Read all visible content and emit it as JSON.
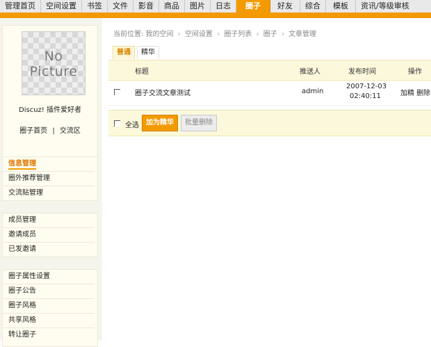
{
  "nav": {
    "tabs": [
      {
        "label": "管理首页"
      },
      {
        "label": "空间设置"
      },
      {
        "label": "书签"
      },
      {
        "label": "文件"
      },
      {
        "label": "影音"
      },
      {
        "label": "商品"
      },
      {
        "label": "图片"
      },
      {
        "label": "日志"
      },
      {
        "label": "圈子",
        "active": true
      },
      {
        "label": "好友"
      },
      {
        "label": "综合"
      },
      {
        "label": "模板"
      },
      {
        "label": "资讯/等级审核"
      }
    ],
    "accent": "#f29a00"
  },
  "sidebar": {
    "avatar_text": {
      "line1": "No",
      "line2": "Picture"
    },
    "profile_name": "Discuz! 插件爱好者",
    "profile_link1": "圈子首页",
    "profile_link_sep": "|",
    "profile_link2": "交流区",
    "group1": [
      "信息管理",
      "圈外推荐管理",
      "交流贴管理"
    ],
    "group2": [
      "成员管理",
      "邀请成员",
      "已发邀请"
    ],
    "group3": [
      "圈子属性设置",
      "圈子公告",
      "圈子风格",
      "共享风格",
      "转让圈子"
    ]
  },
  "main": {
    "breadcrumb": {
      "prefix": "当前位置: 我的空间",
      "items": [
        "空间设置",
        "圈子列表",
        "圈子",
        "文章管理"
      ],
      "sep": "›"
    },
    "subtabs": [
      "普通",
      "精华"
    ],
    "table": {
      "headers": {
        "title": "标题",
        "sender": "推送人",
        "time": "发布时间",
        "action": "操作"
      },
      "rows": [
        {
          "title": "圈子交流文章测试",
          "sender": "admin",
          "date": "2007-12-03",
          "time": "02:40:11",
          "action1": "加精",
          "action2": "删除"
        }
      ]
    },
    "actions": {
      "select_all": "全选",
      "primary": "加为精华",
      "secondary": "批量删除"
    }
  }
}
